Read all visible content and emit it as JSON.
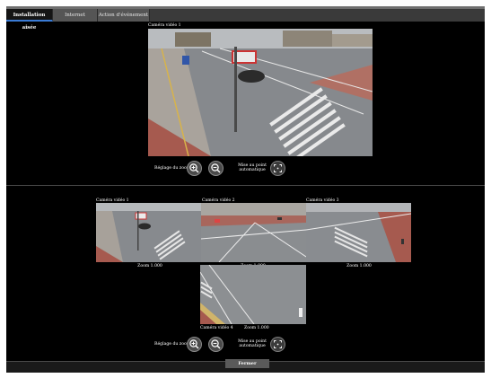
{
  "tabs": [
    {
      "label": "Installation aisée",
      "active": true
    },
    {
      "label": "Internet",
      "active": false
    },
    {
      "label": "Action d'événement",
      "active": false
    }
  ],
  "main_view": {
    "camera_title": "Caméra vidéo 1",
    "zoom_label": "Réglage du zoom",
    "focus_label_line1": "Mise au point",
    "focus_label_line2": "automatique",
    "zoom_in_icon": "zoom-in-icon",
    "zoom_out_icon": "zoom-out-icon",
    "autofocus_icon": "autofocus-icon"
  },
  "multi_view": {
    "cameras": [
      {
        "title": "Caméra vidéo 1",
        "zoom": "Zoom 1.000"
      },
      {
        "title": "Caméra vidéo 2",
        "zoom": "Zoom 1.000"
      },
      {
        "title": "Caméra vidéo 3",
        "zoom": "Zoom 1.000"
      },
      {
        "title": "Caméra vidéo 4",
        "zoom": "Zoom 1.000"
      }
    ],
    "zoom_label": "Réglage du zoom",
    "focus_label_line1": "Mise au point",
    "focus_label_line2": "automatique"
  },
  "footer": {
    "close_label": "Fermer"
  },
  "colors": {
    "accent": "#3a7bd5",
    "background": "#000000"
  }
}
